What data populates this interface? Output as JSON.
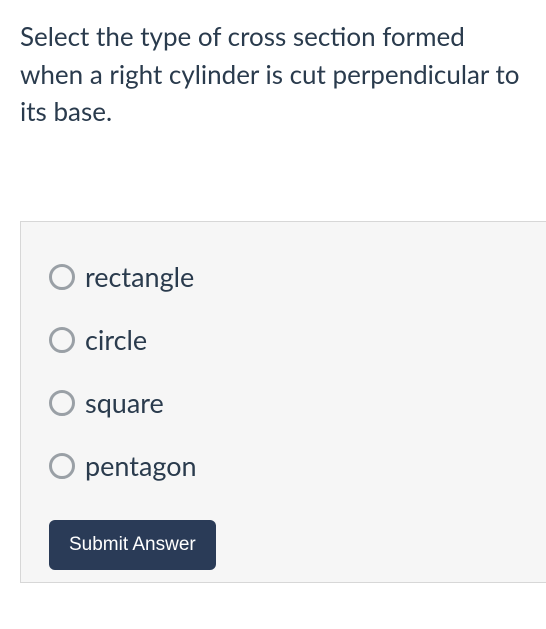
{
  "question": {
    "prompt": "Select the type of cross section formed when a right cylinder is cut perpendicular to its base."
  },
  "options": [
    {
      "label": "rectangle"
    },
    {
      "label": "circle"
    },
    {
      "label": "square"
    },
    {
      "label": "pentagon"
    }
  ],
  "submit": {
    "label": "Submit Answer"
  }
}
